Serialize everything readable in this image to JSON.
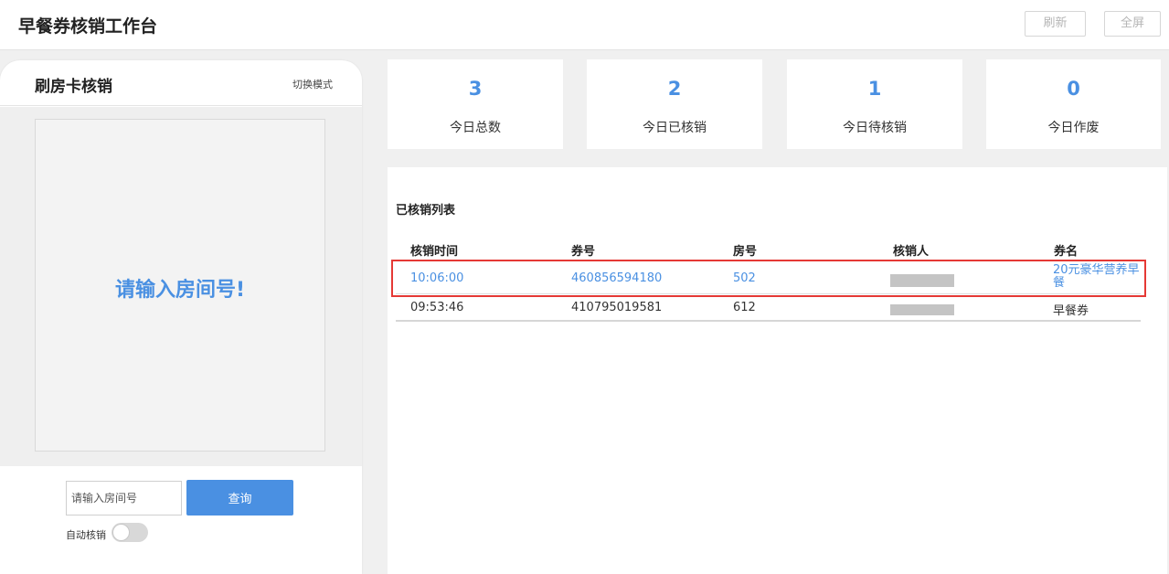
{
  "header": {
    "title": "早餐券核销工作台",
    "refresh_label": "刷新",
    "fullscreen_label": "全屏"
  },
  "phone": {
    "title": "刷房卡核销",
    "switch_mode_label": "切换模式",
    "prompt": "请输入房间号!",
    "room_input_placeholder": "请输入房间号",
    "query_label": "查询",
    "auto_verify_label": "自动核销",
    "auto_verify_on": false
  },
  "stats": [
    {
      "value": "3",
      "label": "今日总数"
    },
    {
      "value": "2",
      "label": "今日已核销"
    },
    {
      "value": "1",
      "label": "今日待核销"
    },
    {
      "value": "0",
      "label": "今日作废"
    }
  ],
  "list": {
    "title": "已核销列表",
    "columns": [
      "核销时间",
      "券号",
      "房号",
      "核销人",
      "券名"
    ],
    "rows": [
      {
        "time": "10:06:00",
        "coupon_no": "460856594180",
        "room": "502",
        "verifier": "",
        "coupon_name": "20元豪华营养早餐",
        "highlighted": true
      },
      {
        "time": "09:53:46",
        "coupon_no": "410795019581",
        "room": "612",
        "verifier": "",
        "coupon_name": "早餐券",
        "highlighted": false
      }
    ]
  },
  "colors": {
    "accent": "#4a90e2",
    "highlight_border": "#e53935",
    "background": "#f0f0f0"
  }
}
